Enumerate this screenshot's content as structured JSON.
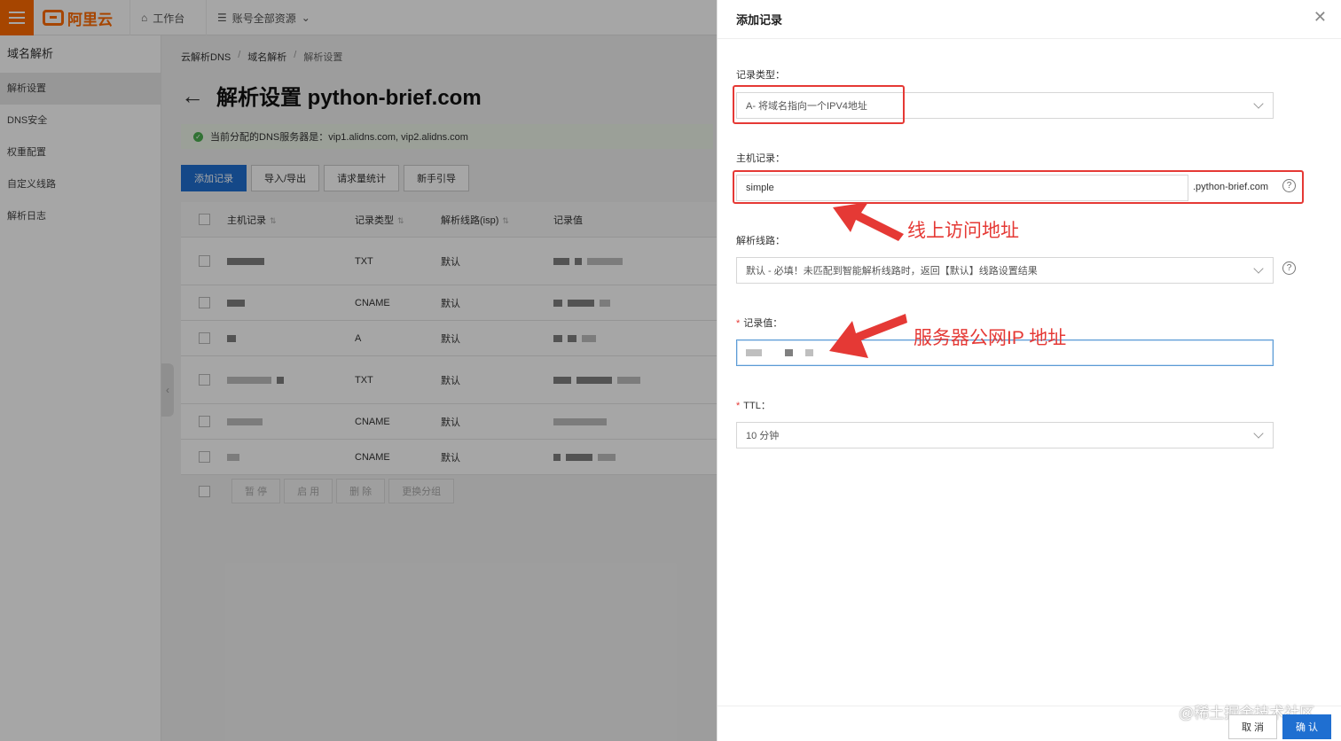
{
  "topbar": {
    "logo_text": "阿里云",
    "workbench": "工作台",
    "resources": "账号全部资源"
  },
  "sidebar": {
    "title": "域名解析",
    "items": [
      {
        "label": "解析设置",
        "active": true
      },
      {
        "label": "DNS安全"
      },
      {
        "label": "权重配置"
      },
      {
        "label": "自定义线路"
      },
      {
        "label": "解析日志"
      }
    ]
  },
  "breadcrumb": [
    "云解析DNS",
    "域名解析",
    "解析设置"
  ],
  "page": {
    "title": "解析设置 python-brief.com",
    "notice": "当前分配的DNS服务器是：vip1.alidns.com, vip2.alidns.com"
  },
  "toolbar": {
    "add": "添加记录",
    "import_export": "导入/导出",
    "stats": "请求量统计",
    "guide": "新手引导"
  },
  "table": {
    "headers": {
      "host": "主机记录",
      "type": "记录类型",
      "line": "解析线路(isp)",
      "value": "记录值"
    },
    "rows": [
      {
        "type": "TXT",
        "line": "默认"
      },
      {
        "type": "CNAME",
        "line": "默认"
      },
      {
        "type": "A",
        "line": "默认"
      },
      {
        "type": "TXT",
        "line": "默认"
      },
      {
        "type": "CNAME",
        "line": "默认"
      },
      {
        "type": "CNAME",
        "line": "默认"
      }
    ],
    "bulk_actions": [
      "暂 停",
      "启 用",
      "删 除",
      "更换分组"
    ]
  },
  "drawer": {
    "title": "添加记录",
    "record_type": {
      "label": "记录类型：",
      "value": "A- 将域名指向一个IPV4地址"
    },
    "host": {
      "label": "主机记录：",
      "value": "simple",
      "suffix": ".python-brief.com"
    },
    "line": {
      "label": "解析线路：",
      "value": "默认 - 必填！未匹配到智能解析线路时，返回【默认】线路设置结果"
    },
    "record_value": {
      "label": "记录值：",
      "required": "*"
    },
    "ttl": {
      "label": "TTL：",
      "required": "*",
      "value": "10 分钟"
    },
    "cancel": "取 消",
    "confirm": "确 认",
    "help_glyph": "?"
  },
  "annotations": {
    "online_address": "线上访问地址",
    "server_ip": "服务器公网IP 地址",
    "color": "#e53935"
  },
  "watermark": "@稀土掘金技术社区"
}
